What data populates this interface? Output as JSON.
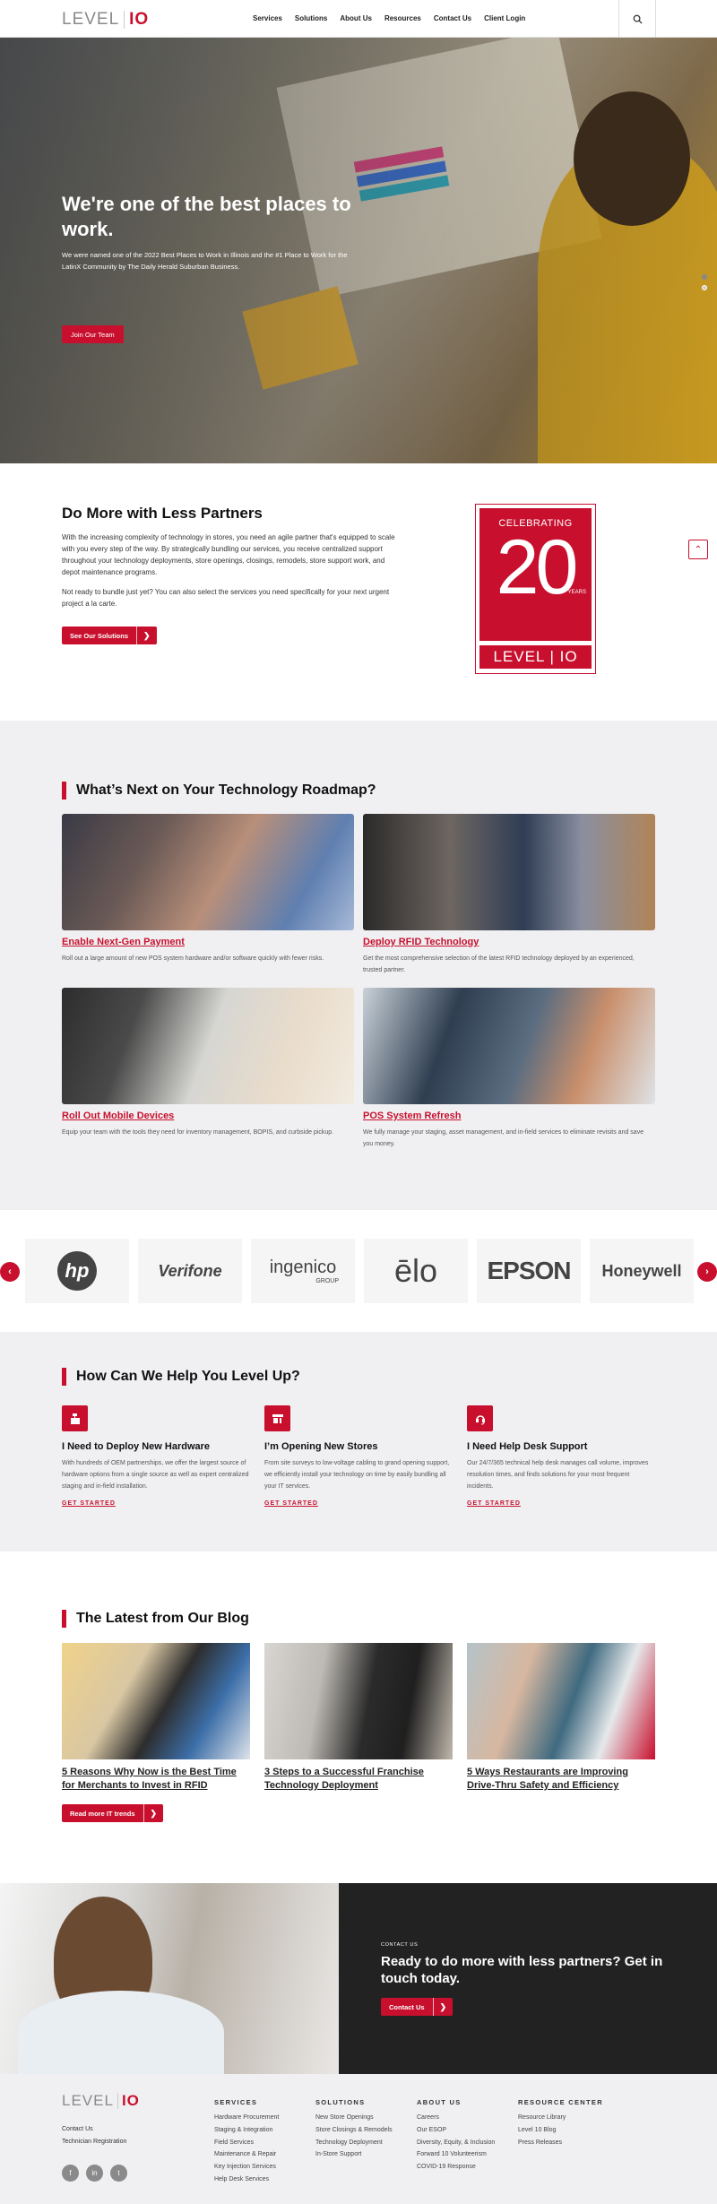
{
  "header": {
    "logo_left": "LEVEL",
    "logo_right": "IO",
    "nav": [
      "Services",
      "Solutions",
      "About Us",
      "Resources",
      "Contact Us",
      "Client Login"
    ],
    "search_icon": "search-icon"
  },
  "hero": {
    "title": "We're one of the best places to work.",
    "subtitle": "We were named one of the 2022 Best Places to Work in Illinois and the #1 Place to Work for the LatinX Community by The Daily Herald Suburban Business.",
    "button": "Join Our Team",
    "slides": 2,
    "active_slide": 2
  },
  "domore": {
    "title": "Do More with Less Partners",
    "p1": "With the increasing complexity of technology in stores, you need an agile partner that's equipped to scale with you every step of the way. By strategically bundling our services, you receive centralized support throughout your technology deployments, store openings, closings, remodels, store support work, and depot maintenance programs.",
    "p2": "Not ready to bundle just yet? You can also select the services you need specifically for your next urgent project a la carte.",
    "button": "See Our Solutions",
    "badge": {
      "top": "CELEBRATING",
      "number": "20",
      "unit": "YEARS",
      "brand": "LEVEL | IO"
    }
  },
  "roadmap": {
    "title": "What’s Next on Your Technology Roadmap?",
    "cards": [
      {
        "title": "Enable Next-Gen Payment",
        "text": "Roll out a large amount of new POS system hardware and/or software quickly with fewer risks."
      },
      {
        "title": "Deploy RFID Technology",
        "text": "Get the most comprehensive selection of the latest RFID technology deployed by an experienced, trusted partner."
      },
      {
        "title": "Roll Out Mobile Devices",
        "text": "Equip your team with the tools they need for inventory management, BOPIS, and curbside pickup."
      },
      {
        "title": "POS System Refresh",
        "text": "We fully manage your staging, asset management, and in-field services to eliminate revisits and save you money."
      }
    ]
  },
  "partners": [
    "hp",
    "Verifone",
    "ingenico",
    "ēlo",
    "EPSON",
    "Honeywell"
  ],
  "partners_sub": {
    "ingenico": "GROUP"
  },
  "help": {
    "title": "How Can We Help You Level Up?",
    "items": [
      {
        "icon": "cash-register-icon",
        "title": "I Need to Deploy New Hardware",
        "text": "With hundreds of OEM partnerships, we offer the largest source of hardware options from a single source as well as expert centralized staging and in-field installation.",
        "link": "GET STARTED"
      },
      {
        "icon": "storefront-icon",
        "title": "I’m Opening New Stores",
        "text": "From site surveys to low-voltage cabling to grand opening support, we efficiently install your technology on time by easily bundling all your IT services.",
        "link": "GET STARTED"
      },
      {
        "icon": "headset-icon",
        "title": "I Need Help Desk Support",
        "text": "Our 24/7/365 technical help desk manages call volume, improves resolution times, and finds solutions for your most frequent incidents.",
        "link": "GET STARTED"
      }
    ]
  },
  "blog": {
    "title": "The Latest from Our Blog",
    "posts": [
      "5 Reasons Why Now is the Best Time for Merchants to Invest in RFID",
      "3 Steps to a Successful Franchise Technology Deployment",
      "5 Ways Restaurants are Improving Drive-Thru Safety and Efficiency"
    ],
    "button": "Read more IT trends"
  },
  "contact": {
    "kicker": "CONTACT US",
    "title": "Ready to do more with less partners? Get in touch today.",
    "button": "Contact Us"
  },
  "footer": {
    "links": [
      "Contact Us",
      "Technician Registration"
    ],
    "social": [
      "f",
      "in",
      "t"
    ],
    "columns": [
      {
        "title": "SERVICES",
        "items": [
          "Hardware Procurement",
          "Staging & Integration",
          "Field Services",
          "Maintenance & Repair",
          "Key Injection Services",
          "Help Desk Services"
        ]
      },
      {
        "title": "SOLUTIONS",
        "items": [
          "New Store Openings",
          "Store Closings & Remodels",
          "Technology Deployment",
          "In-Store Support"
        ]
      },
      {
        "title": "ABOUT US",
        "items": [
          "Careers",
          "Our ESOP",
          "Diversity, Equity, & Inclusion",
          "Forward 10 Volunteerism",
          "COVID-19 Response"
        ]
      },
      {
        "title": "RESOURCE CENTER",
        "items": [
          "Resource Library",
          "Level 10 Blog",
          "Press Releases"
        ]
      }
    ]
  },
  "colors": {
    "brand_red": "#c8102e",
    "dark": "#222222",
    "light_bg": "#f0f0f2"
  }
}
